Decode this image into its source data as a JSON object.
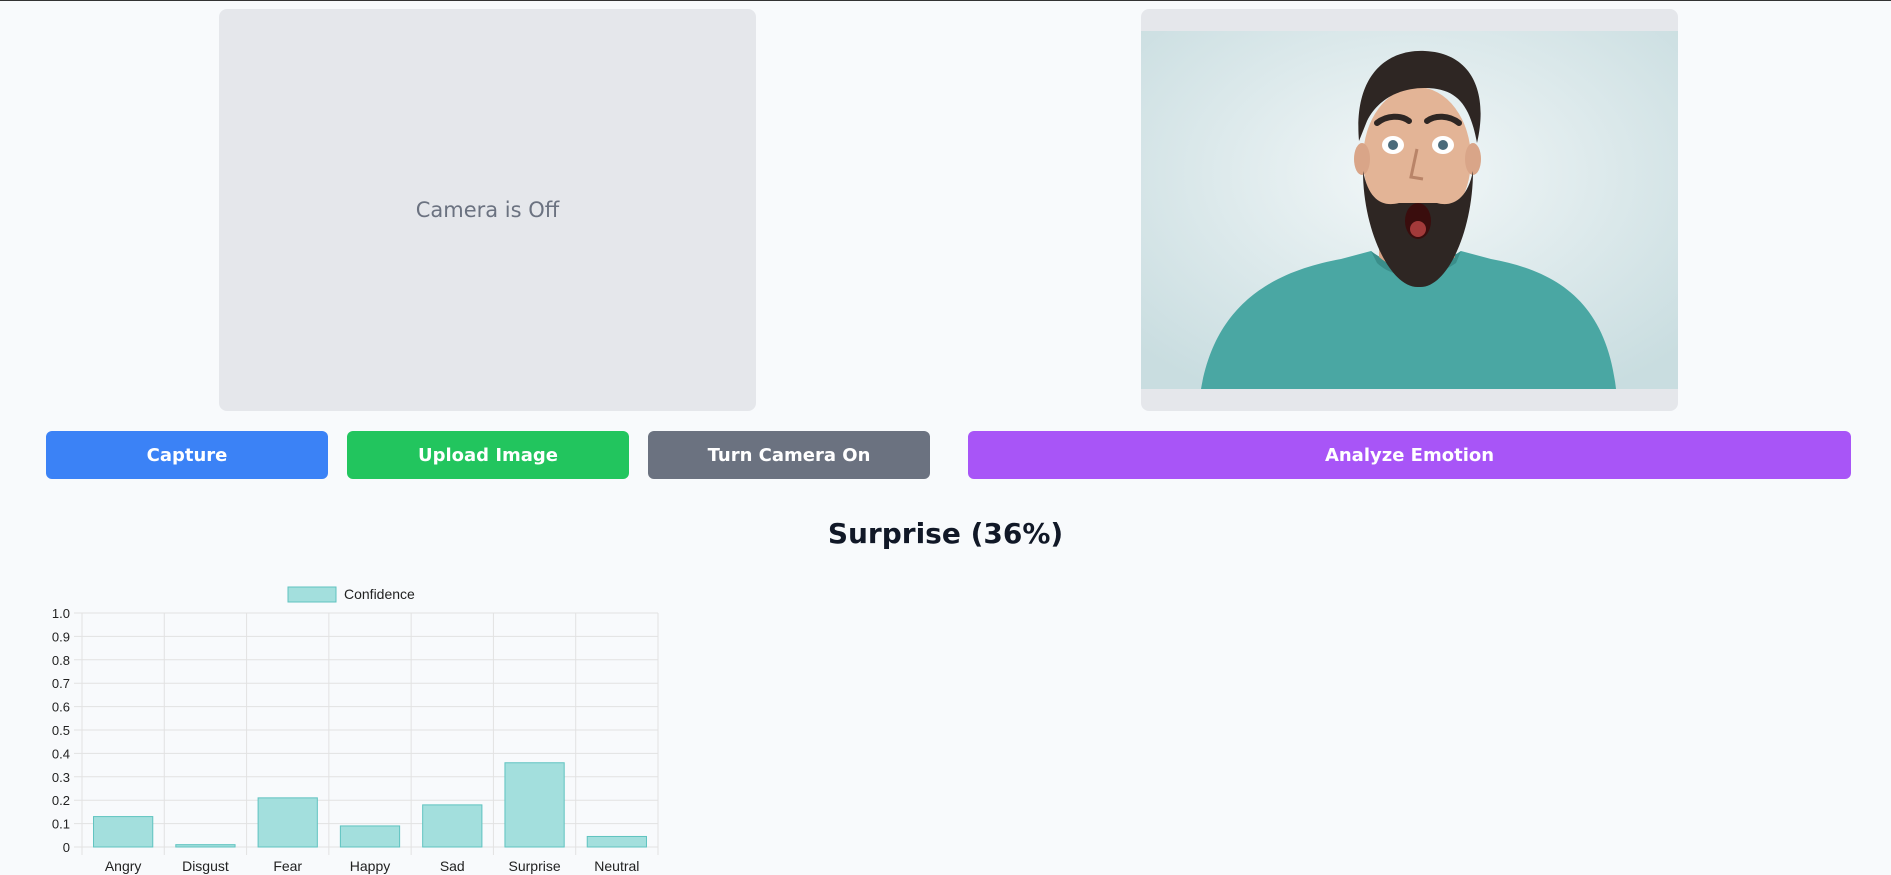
{
  "camera": {
    "status_text": "Camera is Off"
  },
  "preview": {
    "image_alt": "uploaded-face-photo"
  },
  "buttons": {
    "capture": "Capture",
    "upload": "Upload Image",
    "camera_toggle": "Turn Camera On",
    "analyze": "Analyze Emotion"
  },
  "colors": {
    "capture": "#3b82f6",
    "upload": "#22c55e",
    "camera_toggle": "#6b7280",
    "analyze": "#a855f7",
    "bar_fill": "#a3dfdd",
    "bar_stroke": "#5fc3c0"
  },
  "result": {
    "label": "Surprise (36%)"
  },
  "chart_data": {
    "type": "bar",
    "categories": [
      "Angry",
      "Disgust",
      "Fear",
      "Happy",
      "Sad",
      "Surprise",
      "Neutral"
    ],
    "series": [
      {
        "name": "Confidence",
        "values": [
          0.13,
          0.01,
          0.21,
          0.09,
          0.18,
          0.36,
          0.045
        ]
      }
    ],
    "ylim": [
      0,
      1.0
    ],
    "yticks": [
      "0",
      "0.1",
      "0.2",
      "0.3",
      "0.4",
      "0.5",
      "0.6",
      "0.7",
      "0.8",
      "0.9",
      "1.0"
    ],
    "grid": true,
    "legend_position": "top"
  }
}
